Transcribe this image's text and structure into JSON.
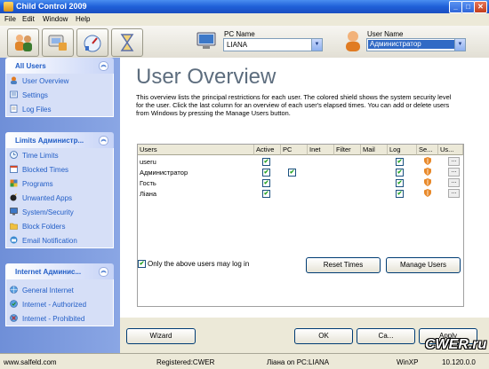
{
  "window": {
    "title": "Child Control 2009"
  },
  "menu": [
    "File",
    "Edit",
    "Window",
    "Help"
  ],
  "toolbar": {
    "pc_label": "PC Name",
    "pc_value": "LIANA",
    "user_label": "User Name",
    "user_value": "Администратор"
  },
  "sidebar": {
    "sections": [
      {
        "title": "All Users",
        "items": [
          "User Overview",
          "Settings",
          "Log Files"
        ]
      },
      {
        "title": "Limits Администр...",
        "items": [
          "Time Limits",
          "Blocked Times",
          "Programs",
          "Unwanted Apps",
          "System/Security",
          "Block Folders",
          "Email Notification"
        ]
      },
      {
        "title": "Internet Админис...",
        "items": [
          "General Internet",
          "Internet - Authorized",
          "Internet - Prohibited"
        ]
      }
    ]
  },
  "main": {
    "title": "User Overview",
    "description": "This overview lists the principal restrictions for each user. The colored shield shows the system security level for the user. Click the last column for an overview of each user's elapsed times. You can add or delete users from Windows by pressing the Manage Users button.",
    "columns": [
      "Users",
      "Active",
      "PC",
      "Inet",
      "Filter",
      "Mail",
      "Log",
      "Se...",
      "Us..."
    ],
    "rows": [
      {
        "name": "useru",
        "active": true,
        "pc": false,
        "inet": false,
        "filter": false,
        "mail": false,
        "log": true,
        "more": "..."
      },
      {
        "name": "Администратор",
        "active": true,
        "pc": true,
        "inet": false,
        "filter": false,
        "mail": false,
        "log": true,
        "more": "..."
      },
      {
        "name": "Гость",
        "active": true,
        "pc": false,
        "inet": false,
        "filter": false,
        "mail": false,
        "log": true,
        "more": "..."
      },
      {
        "name": "Ліана",
        "active": true,
        "pc": false,
        "inet": false,
        "filter": false,
        "mail": false,
        "log": true,
        "more": "..."
      }
    ],
    "only_above_label": "Only the above users may log in",
    "reset_times": "Reset Times",
    "manage_users": "Manage Users"
  },
  "buttons": {
    "wizard": "Wizard",
    "ok": "OK",
    "cancel": "Ca...",
    "apply": "Apply"
  },
  "status": {
    "site": "www.salfeld.com",
    "registered": "Registered:CWER",
    "user_on_pc": "Ліана on PC:LIANA",
    "os": "WinXP",
    "version": "10.120.0.0"
  },
  "watermark": "CWER.ru",
  "colors": {
    "title_blue": "#1f5fd8",
    "sidebar_blue": "#7b98dc",
    "heading_gray": "#5d6d7e",
    "check_green": "#21a121",
    "shield_orange": "#e8892a"
  }
}
